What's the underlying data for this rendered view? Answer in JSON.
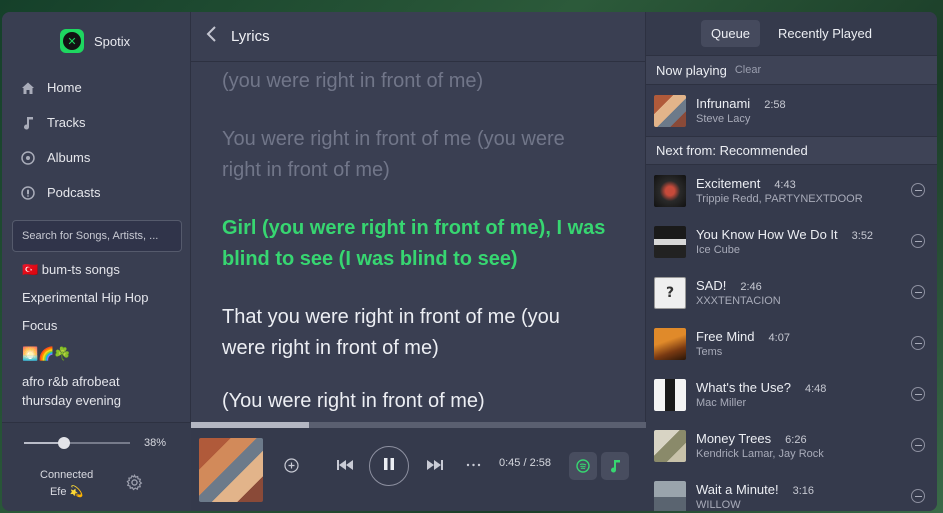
{
  "app": {
    "name": "Spotix"
  },
  "sidebar": {
    "nav": [
      {
        "label": "Home",
        "icon": "home-icon"
      },
      {
        "label": "Tracks",
        "icon": "music-note-icon"
      },
      {
        "label": "Albums",
        "icon": "disc-icon"
      },
      {
        "label": "Podcasts",
        "icon": "podcast-icon"
      }
    ],
    "search_placeholder": "Search for Songs, Artists, ...",
    "playlists": [
      "🇹🇷 bum-ts songs",
      "Experimental Hip Hop",
      "Focus",
      "🌅🌈☘️",
      "afro r&b afrobeat thursday evening"
    ],
    "volume_percent": 38,
    "volume_label": "38%",
    "connection_status": "Connected",
    "connection_user": "Efe 💫"
  },
  "main": {
    "title": "Lyrics",
    "lyrics": [
      {
        "text": "(you were right in front of me)",
        "state": "past"
      },
      {
        "text": "You were right in front of me (you were right in front of me)",
        "state": "past"
      },
      {
        "text": "Girl (you were right in front of me), I was blind to see (I was blind to see)",
        "state": "active"
      },
      {
        "text": "That you were right in front of me (you were right in front of me)",
        "state": "upcoming"
      },
      {
        "text": "(You were right in front of me)",
        "state": "upcoming"
      }
    ]
  },
  "player": {
    "progress_fraction": 0.26,
    "time_label": "0:45 / 2:58",
    "state": "playing"
  },
  "queue": {
    "tabs": [
      {
        "label": "Queue",
        "active": true
      },
      {
        "label": "Recently Played",
        "active": false
      }
    ],
    "now_playing_label": "Now playing",
    "clear_label": "Clear",
    "now_playing": {
      "title": "Infrunami",
      "duration": "2:58",
      "artist": "Steve Lacy"
    },
    "next_from_label": "Next from: Recommended",
    "next": [
      {
        "title": "Excitement",
        "duration": "4:43",
        "artist": "Trippie Redd, PARTYNEXTDOOR"
      },
      {
        "title": "You Know How We Do It",
        "duration": "3:52",
        "artist": "Ice Cube"
      },
      {
        "title": "SAD!",
        "duration": "2:46",
        "artist": "XXXTENTACION"
      },
      {
        "title": "Free Mind",
        "duration": "4:07",
        "artist": "Tems"
      },
      {
        "title": "What's the Use?",
        "duration": "4:48",
        "artist": "Mac Miller"
      },
      {
        "title": "Money Trees",
        "duration": "6:26",
        "artist": "Kendrick Lamar, Jay Rock"
      },
      {
        "title": "Wait a Minute!",
        "duration": "3:16",
        "artist": "WILLOW"
      }
    ]
  },
  "colors": {
    "accent": "#37d671",
    "background": "#3a3f52"
  }
}
